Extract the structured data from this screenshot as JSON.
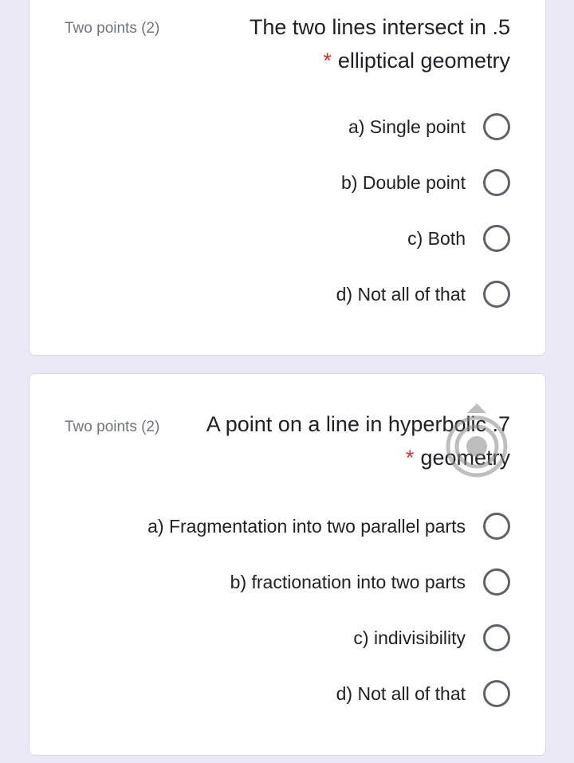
{
  "questions": [
    {
      "points": "Two points (2)",
      "line1": "The two lines intersect in .5",
      "required_mark": "*",
      "line2": "elliptical geometry",
      "options": [
        "a) Single point",
        "b) Double point",
        "c) Both",
        "d) Not all of that"
      ]
    },
    {
      "points": "Two points (2)",
      "line1": "A point on a line in hyperbolic .7",
      "required_mark": "*",
      "line2": "geometry",
      "options": [
        "a) Fragmentation into two parallel parts",
        "b) fractionation into two parts",
        "c) indivisibility",
        "d) Not all of that"
      ]
    }
  ],
  "icons": {
    "radio": "radio-unchecked-icon",
    "watermark": "target-overlay-icon"
  },
  "colors": {
    "background": "#ece9f6",
    "card": "#ffffff",
    "required": "#d93025",
    "radio_border": "#5f6368"
  }
}
